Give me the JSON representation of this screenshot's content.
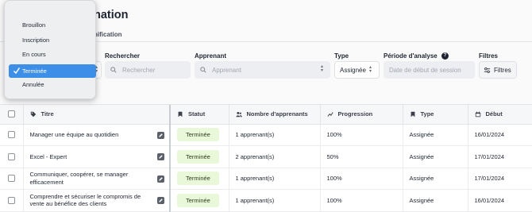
{
  "page": {
    "title_partial": "nation",
    "subtab_partial": "nification"
  },
  "filters": {
    "rechercher": {
      "label": "Rechercher",
      "placeholder": "Rechercher"
    },
    "apprenant": {
      "label": "Apprenant",
      "placeholder": "Apprenant"
    },
    "type": {
      "label": "Type",
      "value": "Assignée"
    },
    "periode": {
      "label": "Période d'analyse",
      "placeholder": "Date de début de session"
    },
    "filtres": {
      "label": "Filtres",
      "button": "Filtres"
    }
  },
  "status_dropdown": {
    "options": [
      "Brouillon",
      "Inscription",
      "En cours",
      "Terminée",
      "Annulée"
    ],
    "selected": "Terminée"
  },
  "table": {
    "headers": {
      "titre": "Titre",
      "statut": "Statut",
      "nombre": "Nombre d'apprenants",
      "progression": "Progression",
      "type": "Type",
      "debut": "Début"
    },
    "rows": [
      {
        "titre": "Manager une équipe au quotidien",
        "statut": "Terminée",
        "nombre": "1 apprenant(s)",
        "progression": "100%",
        "type": "Assignée",
        "debut": "16/01/2024"
      },
      {
        "titre": "Excel - Expert",
        "statut": "Terminée",
        "nombre": "2 apprenant(s)",
        "progression": "50%",
        "type": "Assignée",
        "debut": "17/01/2024"
      },
      {
        "titre": "Communiquer, coopérer, se manager efficacement",
        "statut": "Terminée",
        "nombre": "1 apprenant(s)",
        "progression": "100%",
        "type": "Assignée",
        "debut": "17/01/2024"
      },
      {
        "titre": "Comprendre et sécuriser le compromis de vente au bénéfice des clients",
        "statut": "Terminée",
        "nombre": "1 apprenant(s)",
        "progression": "100%",
        "type": "Assignée",
        "debut": "16/01/2024"
      }
    ]
  },
  "colors": {
    "accent": "#3d8ee6",
    "status_badge_bg": "#e8f8d9",
    "text": "#1f2430"
  },
  "icons": [
    "search-icon",
    "help-icon",
    "filter-sliders-icon",
    "tag-icon",
    "bookmark-icon",
    "users-icon",
    "trend-icon",
    "calendar-icon",
    "edit-icon",
    "check-icon",
    "up-down-chevron-icon"
  ]
}
